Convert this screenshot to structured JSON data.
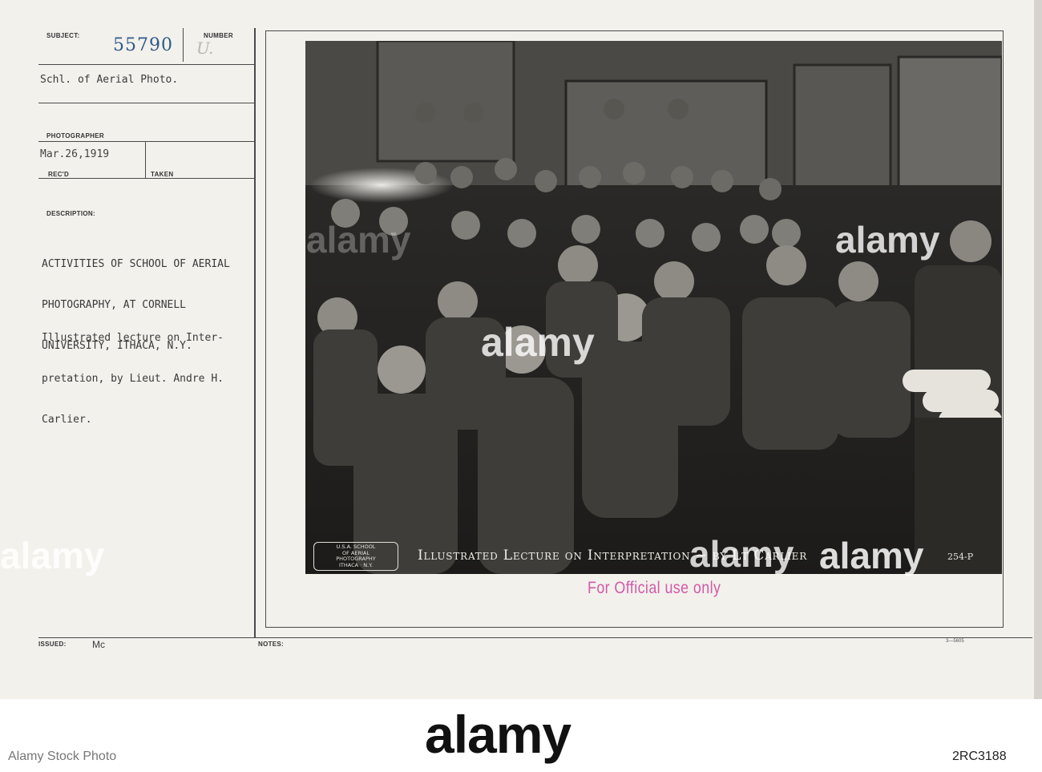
{
  "record": {
    "subject_label": "SUBJECT:",
    "subject_number": "55790",
    "number_label": "NUMBER",
    "number_mark": "U.",
    "subject_text": "Schl. of Aerial Photo.",
    "photographer_label": "PHOTOGRAPHER",
    "date": "Mar.26,1919",
    "recd_label": "REC'D",
    "taken_label": "TAKEN",
    "description_label": "DESCRIPTION:",
    "description_lines": [
      "ACTIVITIES OF SCHOOL OF AERIAL",
      "PHOTOGRAPHY, AT CORNELL",
      "UNIVERSITY, ITHACA, N.Y."
    ],
    "lecture_lines": [
      "Illustrated lecture on Inter-",
      "pretation, by Lieut. Andre H.",
      "Carlier."
    ],
    "issued_label": "ISSUED:",
    "issued_value": "Mc",
    "notes_label": "NOTES:",
    "form_code": "3—5605"
  },
  "photo": {
    "caption": "Illustrated Lecture on Interpretation ~ by Lt Carlier",
    "negative_number": "254-P",
    "stamp_lines": [
      "U.S.A. SCHOOL",
      "OF AERIAL",
      "PHOTOGRAPHY",
      "ITHACA · N.Y."
    ]
  },
  "stamp": {
    "official": "For Official use only",
    "color": "#d35aa8"
  },
  "watermark": {
    "text": "alamy",
    "footer_text": "Alamy Stock Photo",
    "image_id": "2RC3188",
    "url": "www.alamy.com"
  }
}
